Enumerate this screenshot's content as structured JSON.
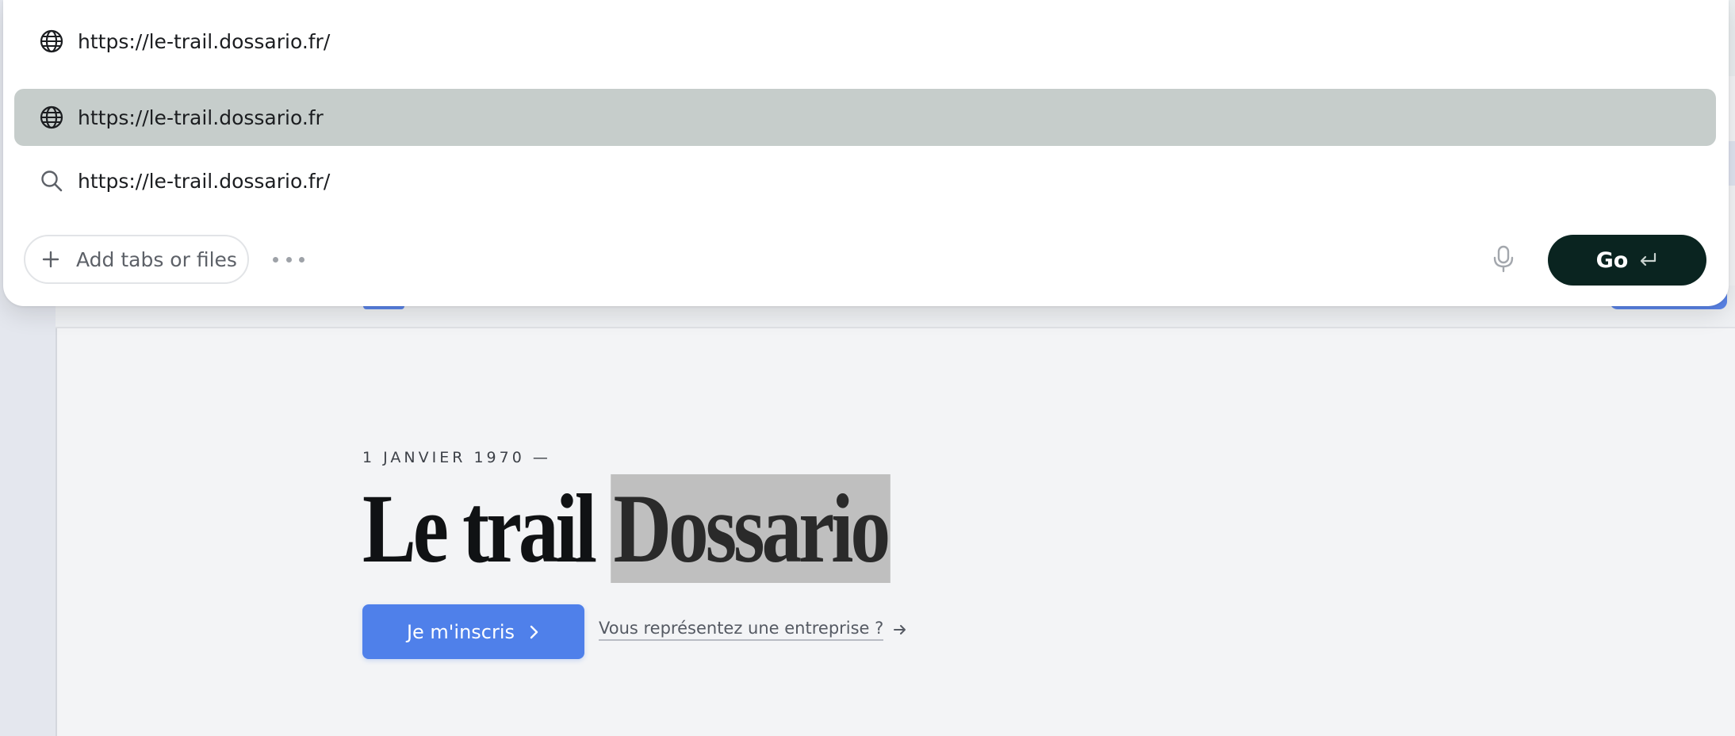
{
  "omnibox": {
    "input_value": "https://le-trail.dossario.fr/",
    "suggestions": [
      {
        "icon": "globe-icon",
        "text": "https://le-trail.dossario.fr",
        "selected": true
      },
      {
        "icon": "search-icon",
        "text": "https://le-trail.dossario.fr/",
        "selected": false
      }
    ],
    "attach_label": "Add tabs or files",
    "go_label": "Go"
  },
  "hero": {
    "date": "1 JANVIER 1970 —",
    "title_plain": "Le trail",
    "title_highlight": "Dossario",
    "primary_cta": "Je m'inscris",
    "secondary_cta": "Vous représentez une entreprise ?"
  },
  "colors": {
    "accent": "#4f80ea",
    "go_button": "#0a2420",
    "selected_row": "#c6cdcb",
    "page_bg": "#f3f4f6"
  }
}
